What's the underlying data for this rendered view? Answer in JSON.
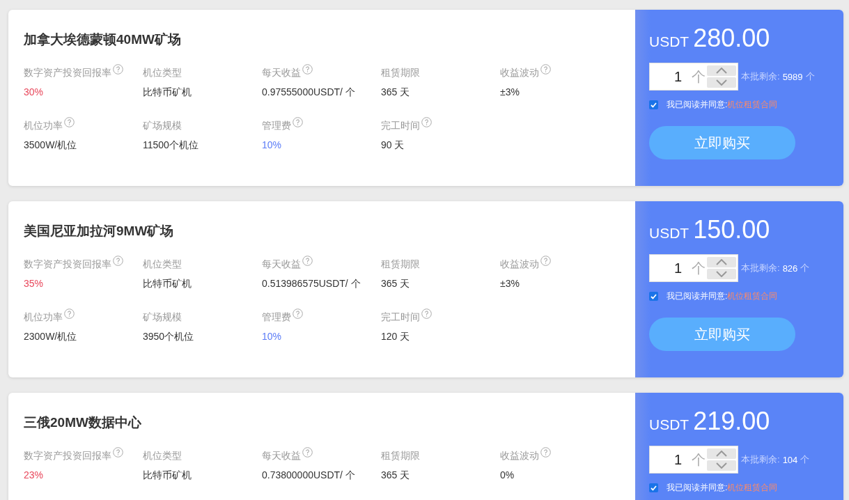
{
  "products": [
    {
      "title": "加拿大埃德蒙顿40MW矿场",
      "stats": [
        {
          "label": "数字资产投资回报率",
          "help": true,
          "value": "30%",
          "kind": "rate"
        },
        {
          "label": "机位类型",
          "help": false,
          "value": "比特币矿机",
          "kind": "plain"
        },
        {
          "label": "每天收益",
          "help": true,
          "value": "0.97555000USDT/ 个",
          "kind": "plain"
        },
        {
          "label": "租赁期限",
          "help": false,
          "value": "365 天",
          "kind": "plain"
        },
        {
          "label": "收益波动",
          "help": true,
          "value": "±3%",
          "kind": "plain"
        },
        {
          "label": "机位功率",
          "help": true,
          "value": "3500W/机位",
          "kind": "plain"
        },
        {
          "label": "矿场规模",
          "help": false,
          "value": "11500个机位",
          "kind": "plain"
        },
        {
          "label": "管理费",
          "help": true,
          "value": "10%",
          "kind": "fee"
        },
        {
          "label": "完工时间",
          "help": true,
          "value": "90 天",
          "kind": "plain"
        }
      ],
      "currency": "USDT",
      "price": "280.00",
      "quantity": "1",
      "unit": "个",
      "remaining_label": "本批剩余:",
      "remaining_count": "5989",
      "remaining_unit": " 个",
      "agree": {
        "checked": true,
        "text": "我已阅读并同意:",
        "link": "机位租赁合同"
      },
      "buy_button": "立即购买"
    },
    {
      "title": "美国尼亚加拉河9MW矿场",
      "stats": [
        {
          "label": "数字资产投资回报率",
          "help": true,
          "value": "35%",
          "kind": "rate"
        },
        {
          "label": "机位类型",
          "help": false,
          "value": "比特币矿机",
          "kind": "plain"
        },
        {
          "label": "每天收益",
          "help": true,
          "value": "0.513986575USDT/ 个",
          "kind": "plain"
        },
        {
          "label": "租赁期限",
          "help": false,
          "value": "365 天",
          "kind": "plain"
        },
        {
          "label": "收益波动",
          "help": true,
          "value": "±3%",
          "kind": "plain"
        },
        {
          "label": "机位功率",
          "help": true,
          "value": "2300W/机位",
          "kind": "plain"
        },
        {
          "label": "矿场规模",
          "help": false,
          "value": "3950个机位",
          "kind": "plain"
        },
        {
          "label": "管理费",
          "help": true,
          "value": "10%",
          "kind": "fee"
        },
        {
          "label": "完工时间",
          "help": true,
          "value": "120 天",
          "kind": "plain"
        }
      ],
      "currency": "USDT",
      "price": "150.00",
      "quantity": "1",
      "unit": "个",
      "remaining_label": "本批剩余:",
      "remaining_count": "826",
      "remaining_unit": " 个",
      "agree": {
        "checked": true,
        "text": "我已阅读并同意:",
        "link": "机位租赁合同"
      },
      "buy_button": "立即购买"
    },
    {
      "title": "三俄20MW数据中心",
      "stats": [
        {
          "label": "数字资产投资回报率",
          "help": true,
          "value": "23%",
          "kind": "rate"
        },
        {
          "label": "机位类型",
          "help": false,
          "value": "比特币矿机",
          "kind": "plain"
        },
        {
          "label": "每天收益",
          "help": true,
          "value": "0.73800000USDT/ 个",
          "kind": "plain"
        },
        {
          "label": "租赁期限",
          "help": false,
          "value": "365 天",
          "kind": "plain"
        },
        {
          "label": "收益波动",
          "help": true,
          "value": "0%",
          "kind": "plain"
        }
      ],
      "currency": "USDT",
      "price": "219.00",
      "quantity": "1",
      "unit": "个",
      "remaining_label": "本批剩余:",
      "remaining_count": "104",
      "remaining_unit": " 个",
      "agree": {
        "checked": true,
        "text": "我已阅读并同意:",
        "link": "机位租赁合同"
      }
    }
  ]
}
